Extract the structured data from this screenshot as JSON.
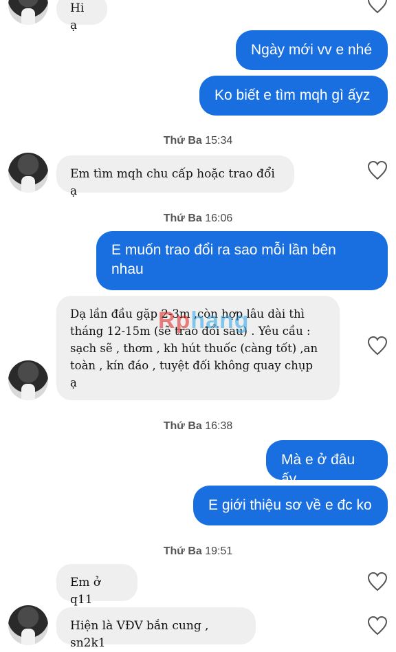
{
  "messages": [
    {
      "id": "m0",
      "side": "in",
      "text": "Hi ạ"
    },
    {
      "id": "m1",
      "side": "out",
      "text": "Ngày mới vv e nhé"
    },
    {
      "id": "m2",
      "side": "out",
      "text": "Ko biết e tìm mqh gì ấyz"
    },
    {
      "id": "t1",
      "day": "Thứ Ba",
      "time": "15:34"
    },
    {
      "id": "m3",
      "side": "in",
      "text": "Em tìm mqh chu cấp hoặc trao đổi ạ"
    },
    {
      "id": "t2",
      "day": "Thứ Ba",
      "time": "16:06"
    },
    {
      "id": "m4",
      "side": "out",
      "lines": [
        "E muốn trao đổi ra sao mỗi lần bên",
        "nhau"
      ]
    },
    {
      "id": "m5",
      "side": "in",
      "lines": [
        "Dạ lần đầu gặp 2-3m ,còn hợp lâu dài thì",
        "tháng 12-15m (sẽ trao đổi sau) . Yêu cầu :",
        "sạch sẽ , thơm , kh hút thuốc (càng tốt) ,an",
        "toàn , kín đáo , tuyệt đối không  quay chụp",
        "ạ"
      ]
    },
    {
      "id": "t3",
      "day": "Thứ Ba",
      "time": "16:38"
    },
    {
      "id": "m6",
      "side": "out",
      "text": "Mà e ở đâu ấy"
    },
    {
      "id": "m7",
      "side": "out",
      "text": "E giới thiệu sơ về e đc ko"
    },
    {
      "id": "t4",
      "day": "Thứ Ba",
      "time": "19:51"
    },
    {
      "id": "m8",
      "side": "in",
      "text": "Em ở q11"
    },
    {
      "id": "m9",
      "side": "in",
      "text": "Hiện là VĐV bắn cung , sn2k1"
    }
  ],
  "watermark": {
    "part1": "Rp",
    "part2": "hang"
  },
  "icons": {
    "like": "heart-outline-icon"
  },
  "colors": {
    "outgoing": "#1a6fe0",
    "incoming": "#efefef",
    "text_in": "#111111"
  }
}
